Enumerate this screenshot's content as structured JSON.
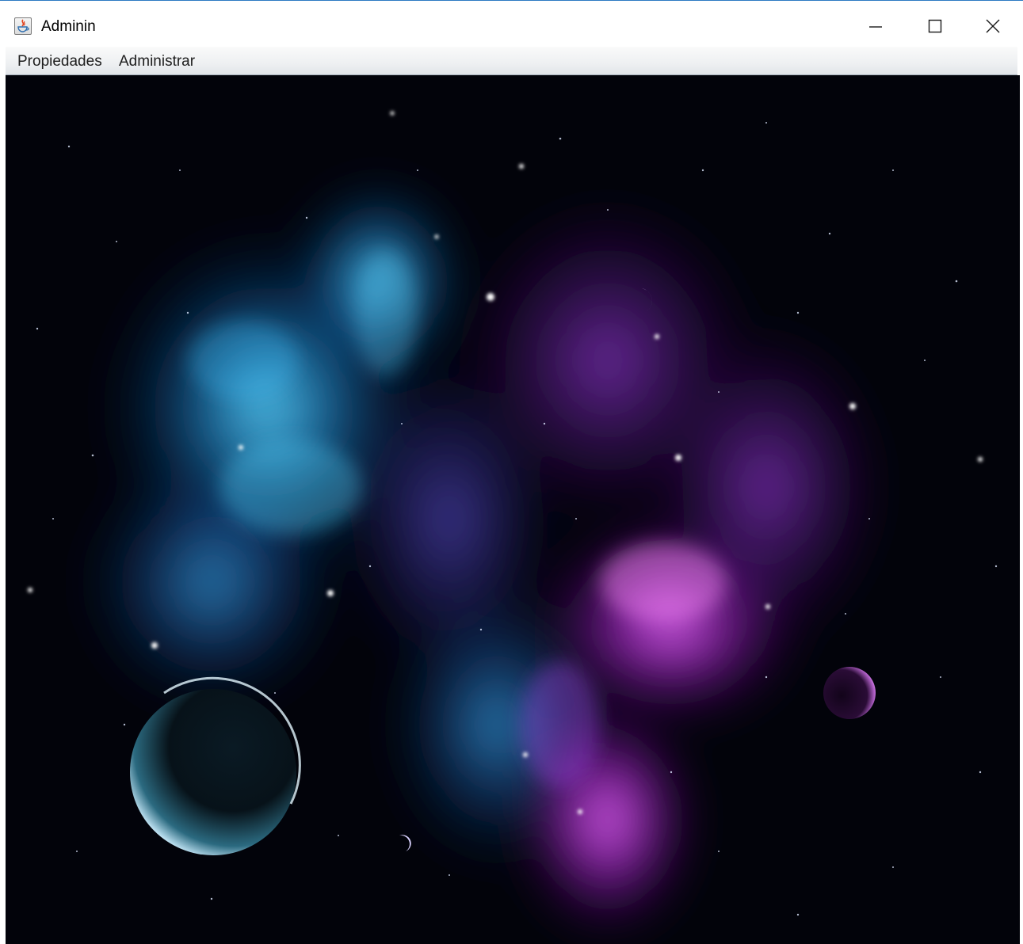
{
  "window": {
    "title": "Adminin",
    "icon": "java-cup-icon",
    "controls": {
      "minimize_icon": "minimize-icon",
      "maximize_icon": "maximize-icon",
      "close_icon": "close-icon"
    }
  },
  "menubar": {
    "items": [
      {
        "label": "Propiedades"
      },
      {
        "label": "Administrar"
      }
    ]
  },
  "content": {
    "image": "space-nebula-background",
    "colors": {
      "left_nebula": "#2fb6f0",
      "right_nebula": "#c028e0",
      "space": "#02030a",
      "accent_border": "#2b79c2"
    }
  }
}
